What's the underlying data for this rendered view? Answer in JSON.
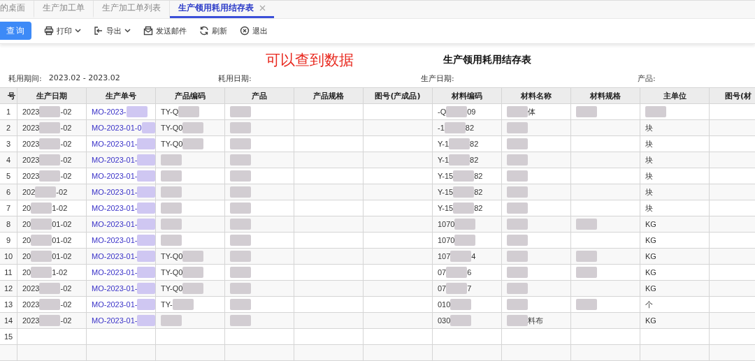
{
  "tabs": [
    {
      "label": "的桌面",
      "selected": false,
      "closable": false
    },
    {
      "label": "生产加工单",
      "selected": false,
      "closable": false
    },
    {
      "label": "生产加工单列表",
      "selected": false,
      "closable": false
    },
    {
      "label": "生产领用耗用结存表",
      "selected": true,
      "closable": true
    }
  ],
  "toolbar": {
    "primary": "查询",
    "actions": [
      {
        "kind": "print",
        "label": "打印",
        "dropdown": true
      },
      {
        "kind": "export",
        "label": "导出",
        "dropdown": true
      },
      {
        "kind": "mail",
        "label": "发送邮件",
        "dropdown": false
      },
      {
        "kind": "refresh",
        "label": "刷新",
        "dropdown": false
      },
      {
        "kind": "exit",
        "label": "退出",
        "dropdown": false
      }
    ]
  },
  "annotation": "可以查到数据",
  "report_title": "生产领用耗用结存表",
  "filters": [
    {
      "label": "耗用期间:",
      "value": "2023.02 - 2023.02"
    },
    {
      "label": "耗用日期:"
    },
    {
      "label": "生产日期:"
    },
    {
      "label": "产品:"
    }
  ],
  "table": {
    "columns": [
      "号",
      "生产日期",
      "生产单号",
      "产品编码",
      "产品",
      "产品规格",
      "图号(产成品)",
      "材料编码",
      "材料名称",
      "材料规格",
      "主单位",
      "图号(材"
    ],
    "rows": [
      [
        {
          "text": "1"
        },
        {
          "text": "2023",
          "redacted": true,
          "after": "-02"
        },
        {
          "text": "MO-2023-",
          "redacted": true,
          "link": true
        },
        {
          "text": "TY-Q",
          "redacted": true
        },
        {
          "redacted": true
        },
        {},
        {},
        {
          "text": "-Q",
          "redacted": true,
          "after": "09"
        },
        {
          "redacted": true,
          "after": "体"
        },
        {
          "redacted": true
        },
        {
          "redacted": true
        },
        {}
      ],
      [
        {
          "text": "2"
        },
        {
          "text": "2023",
          "redacted": true,
          "after": "-02"
        },
        {
          "text": "MO-2023-01-0",
          "redacted": true,
          "link": true
        },
        {
          "text": "TY-Q0",
          "redacted": true
        },
        {
          "redacted": true
        },
        {},
        {},
        {
          "text": "-1",
          "redacted": true,
          "after": "82"
        },
        {
          "redacted": true
        },
        {},
        {
          "text": "块"
        },
        {}
      ],
      [
        {
          "text": "3"
        },
        {
          "text": "2023",
          "redacted": true,
          "after": "-02"
        },
        {
          "text": "MO-2023-01-",
          "redacted": true,
          "link": true
        },
        {
          "text": "TY-Q0",
          "redacted": true
        },
        {
          "redacted": true
        },
        {},
        {},
        {
          "text": "Y-1",
          "redacted": true,
          "after": "82"
        },
        {
          "redacted": true
        },
        {},
        {
          "text": "块"
        },
        {}
      ],
      [
        {
          "text": "4"
        },
        {
          "text": "2023",
          "redacted": true,
          "after": "-02"
        },
        {
          "text": "MO-2023-01-",
          "redacted": true,
          "link": true
        },
        {
          "redacted": true
        },
        {
          "redacted": true
        },
        {},
        {},
        {
          "text": "Y-1",
          "redacted": true,
          "after": "82"
        },
        {
          "redacted": true
        },
        {},
        {
          "text": "块"
        },
        {}
      ],
      [
        {
          "text": "5"
        },
        {
          "text": "2023",
          "redacted": true,
          "after": "-02"
        },
        {
          "text": "MO-2023-01-",
          "redacted": true,
          "link": true
        },
        {
          "redacted": true
        },
        {
          "redacted": true
        },
        {},
        {},
        {
          "text": "Y-15",
          "redacted": true,
          "after": "82"
        },
        {
          "redacted": true
        },
        {},
        {
          "text": "块"
        },
        {}
      ],
      [
        {
          "text": "6"
        },
        {
          "text": "202",
          "redacted": true,
          "after": "-02"
        },
        {
          "text": "MO-2023-01-",
          "redacted": true,
          "link": true
        },
        {
          "redacted": true
        },
        {
          "redacted": true
        },
        {},
        {},
        {
          "text": "Y-15",
          "redacted": true,
          "after": "82"
        },
        {
          "redacted": true
        },
        {},
        {
          "text": "块"
        },
        {}
      ],
      [
        {
          "text": "7"
        },
        {
          "text": "20",
          "redacted": true,
          "after": "1-02"
        },
        {
          "text": "MO-2023-01-",
          "redacted": true,
          "link": true
        },
        {
          "redacted": true
        },
        {
          "redacted": true
        },
        {},
        {},
        {
          "text": "Y-15",
          "redacted": true,
          "after": "82"
        },
        {
          "redacted": true
        },
        {},
        {
          "text": "块"
        },
        {}
      ],
      [
        {
          "text": "8"
        },
        {
          "text": "20",
          "redacted": true,
          "after": "01-02"
        },
        {
          "text": "MO-2023-01-",
          "redacted": true,
          "link": true
        },
        {
          "redacted": true
        },
        {
          "redacted": true
        },
        {},
        {},
        {
          "text": "1070",
          "redacted": true
        },
        {
          "redacted": true
        },
        {
          "redacted": true
        },
        {
          "text": "KG"
        },
        {}
      ],
      [
        {
          "text": "9"
        },
        {
          "text": "20",
          "redacted": true,
          "after": "01-02"
        },
        {
          "text": "MO-2023-01-",
          "redacted": true,
          "link": true
        },
        {
          "redacted": true
        },
        {
          "redacted": true
        },
        {},
        {},
        {
          "text": "1070",
          "redacted": true
        },
        {
          "redacted": true
        },
        {},
        {
          "text": "KG"
        },
        {}
      ],
      [
        {
          "text": "10"
        },
        {
          "text": "20",
          "redacted": true,
          "after": "01-02"
        },
        {
          "text": "MO-2023-01-",
          "redacted": true,
          "link": true
        },
        {
          "text": "TY-Q0",
          "redacted": true
        },
        {
          "redacted": true
        },
        {},
        {},
        {
          "text": "107",
          "redacted": true,
          "after": "4"
        },
        {
          "redacted": true
        },
        {
          "redacted": true
        },
        {
          "text": "KG"
        },
        {}
      ],
      [
        {
          "text": "11"
        },
        {
          "text": "20",
          "redacted": true,
          "after": "1-02"
        },
        {
          "text": "MO-2023-01-",
          "redacted": true,
          "link": true
        },
        {
          "text": "TY-Q0",
          "redacted": true
        },
        {
          "redacted": true
        },
        {},
        {},
        {
          "text": "07",
          "redacted": true,
          "after": "6"
        },
        {
          "redacted": true
        },
        {
          "redacted": true
        },
        {
          "text": "KG"
        },
        {}
      ],
      [
        {
          "text": "12"
        },
        {
          "text": "2023",
          "redacted": true,
          "after": "-02"
        },
        {
          "text": "MO-2023-01-",
          "redacted": true,
          "link": true
        },
        {
          "text": "TY-Q0",
          "redacted": true
        },
        {
          "redacted": true
        },
        {},
        {},
        {
          "text": "07",
          "redacted": true,
          "after": "7"
        },
        {
          "redacted": true
        },
        {},
        {
          "text": "KG"
        },
        {}
      ],
      [
        {
          "text": "13"
        },
        {
          "text": "2023",
          "redacted": true,
          "after": "-02"
        },
        {
          "text": "MO-2023-01-",
          "redacted": true,
          "link": true
        },
        {
          "text": "TY-",
          "redacted": true
        },
        {
          "redacted": true
        },
        {},
        {},
        {
          "text": "010",
          "redacted": true
        },
        {
          "redacted": true
        },
        {
          "redacted": true
        },
        {
          "text": "个"
        },
        {}
      ],
      [
        {
          "text": "14"
        },
        {
          "text": "2023",
          "redacted": true,
          "after": "-02"
        },
        {
          "text": "MO-2023-01-",
          "redacted": true,
          "link": true
        },
        {
          "redacted": true
        },
        {
          "redacted": true
        },
        {},
        {},
        {
          "text": "030",
          "redacted": true
        },
        {
          "redacted": true,
          "after": "料布"
        },
        {},
        {
          "text": "KG"
        },
        {}
      ],
      [
        {
          "text": "15"
        },
        {},
        {},
        {},
        {},
        {},
        {},
        {},
        {},
        {},
        {},
        {}
      ],
      [
        {},
        {},
        {},
        {},
        {},
        {},
        {},
        {},
        {},
        {},
        {},
        {}
      ]
    ]
  }
}
